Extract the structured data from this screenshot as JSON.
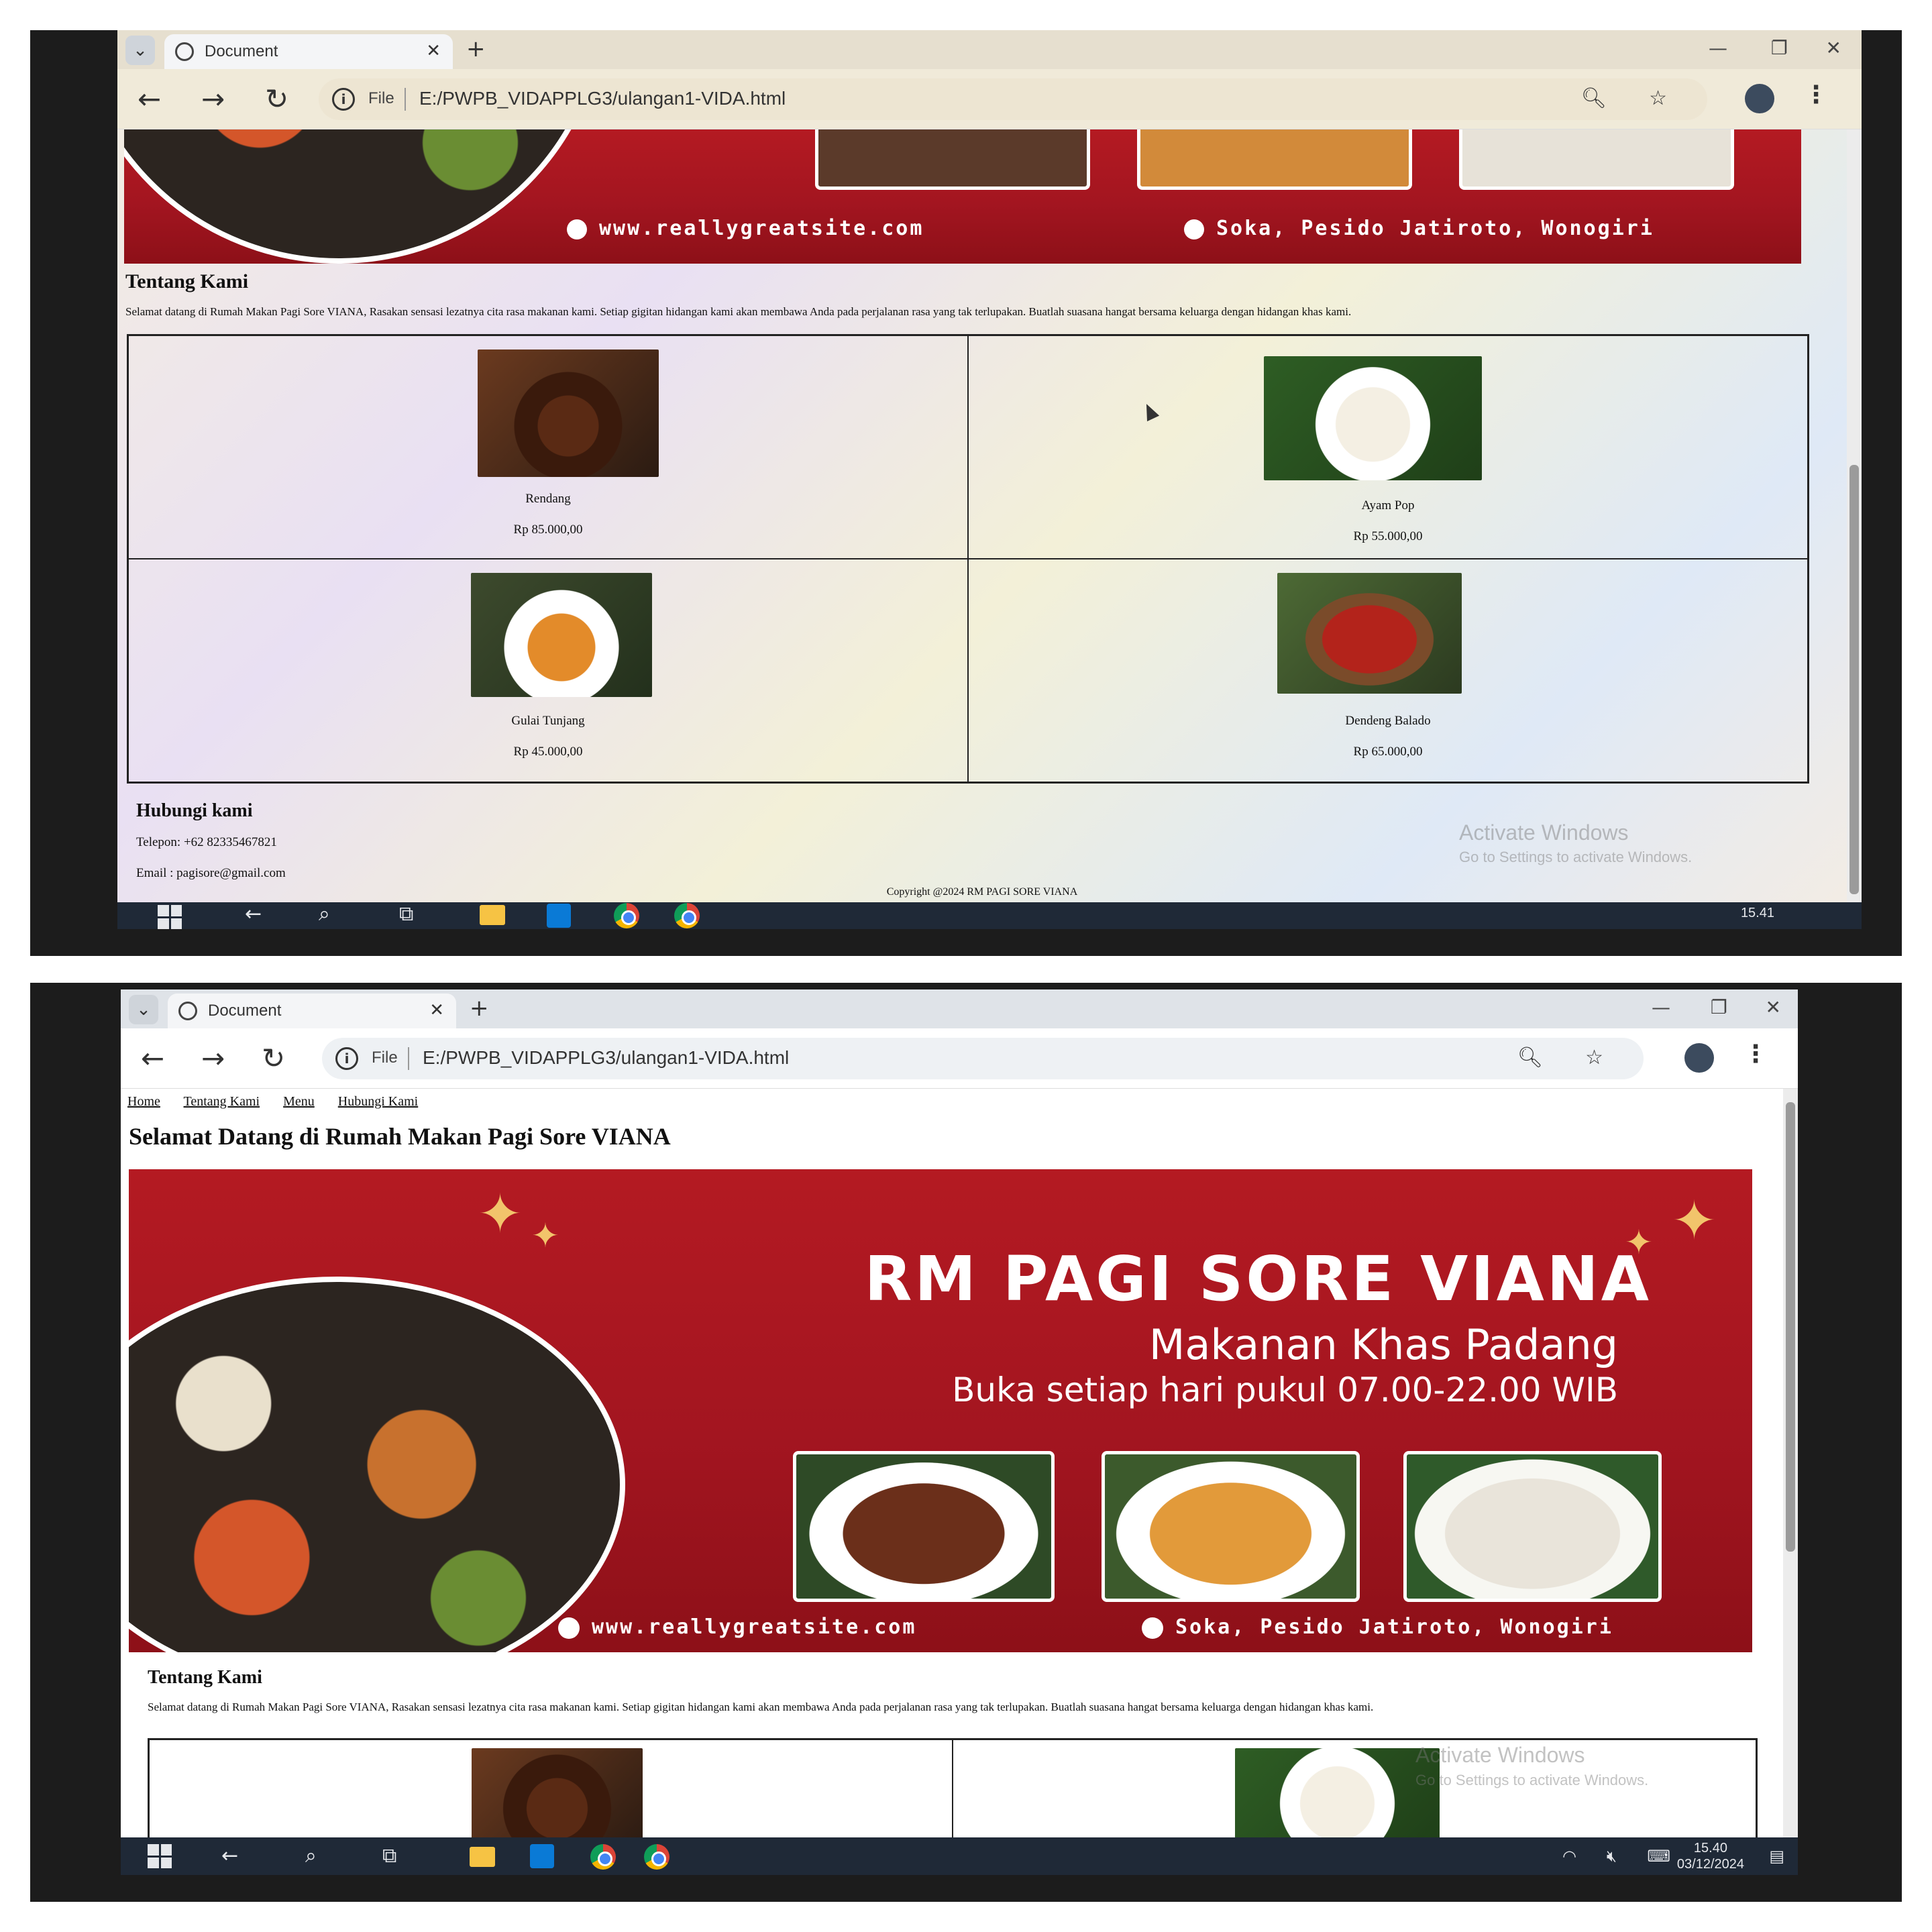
{
  "browser": {
    "tab_title": "Document",
    "new_tab": "+",
    "scheme": "File",
    "url": "E:/PWPB_VIDAPPLG3/ulangan1-VIDA.html"
  },
  "nav": {
    "home": "Home",
    "about": "Tentang Kami",
    "menu": "Menu",
    "contact": "Hubungi Kami"
  },
  "page": {
    "welcome": "Selamat Datang di Rumah Makan Pagi Sore VIANA"
  },
  "banner": {
    "title": "RM PAGI SORE VIANA",
    "subtitle": "Makanan Khas Padang",
    "hours": "Buka setiap hari pukul 07.00-22.00 WIB",
    "website": "www.reallygreatsite.com",
    "address": "Soka, Pesido Jatiroto, Wonogiri",
    "accent_color": "#b41a22"
  },
  "about": {
    "title": "Tentang Kami",
    "text": "Selamat datang di Rumah Makan Pagi Sore VIANA, Rasakan sensasi lezatnya cita rasa makanan kami. Setiap gigitan hidangan kami akan membawa Anda pada perjalanan rasa yang tak terlupakan. Buatlah suasana hangat bersama keluarga dengan hidangan khas kami."
  },
  "menu": {
    "items": [
      {
        "name": "Rendang",
        "price": "Rp 85.000,00"
      },
      {
        "name": "Ayam Pop",
        "price": "Rp 55.000,00"
      },
      {
        "name": "Gulai Tunjang",
        "price": "Rp 45.000,00"
      },
      {
        "name": "Dendeng Balado",
        "price": "Rp 65.000,00"
      }
    ]
  },
  "contact": {
    "title": "Hubungi kami",
    "phone": "Telepon: +62 82335467821",
    "email": "Email : pagisore@gmail.com"
  },
  "footer": {
    "copyright": "Copyright @2024 RM PAGI SORE VIANA"
  },
  "system": {
    "watermark_title": "Activate Windows",
    "watermark_sub": "Go to Settings to activate Windows.",
    "clock_top": "15.41",
    "clock_bottom_time": "15.40",
    "clock_bottom_date": "03/12/2024"
  }
}
